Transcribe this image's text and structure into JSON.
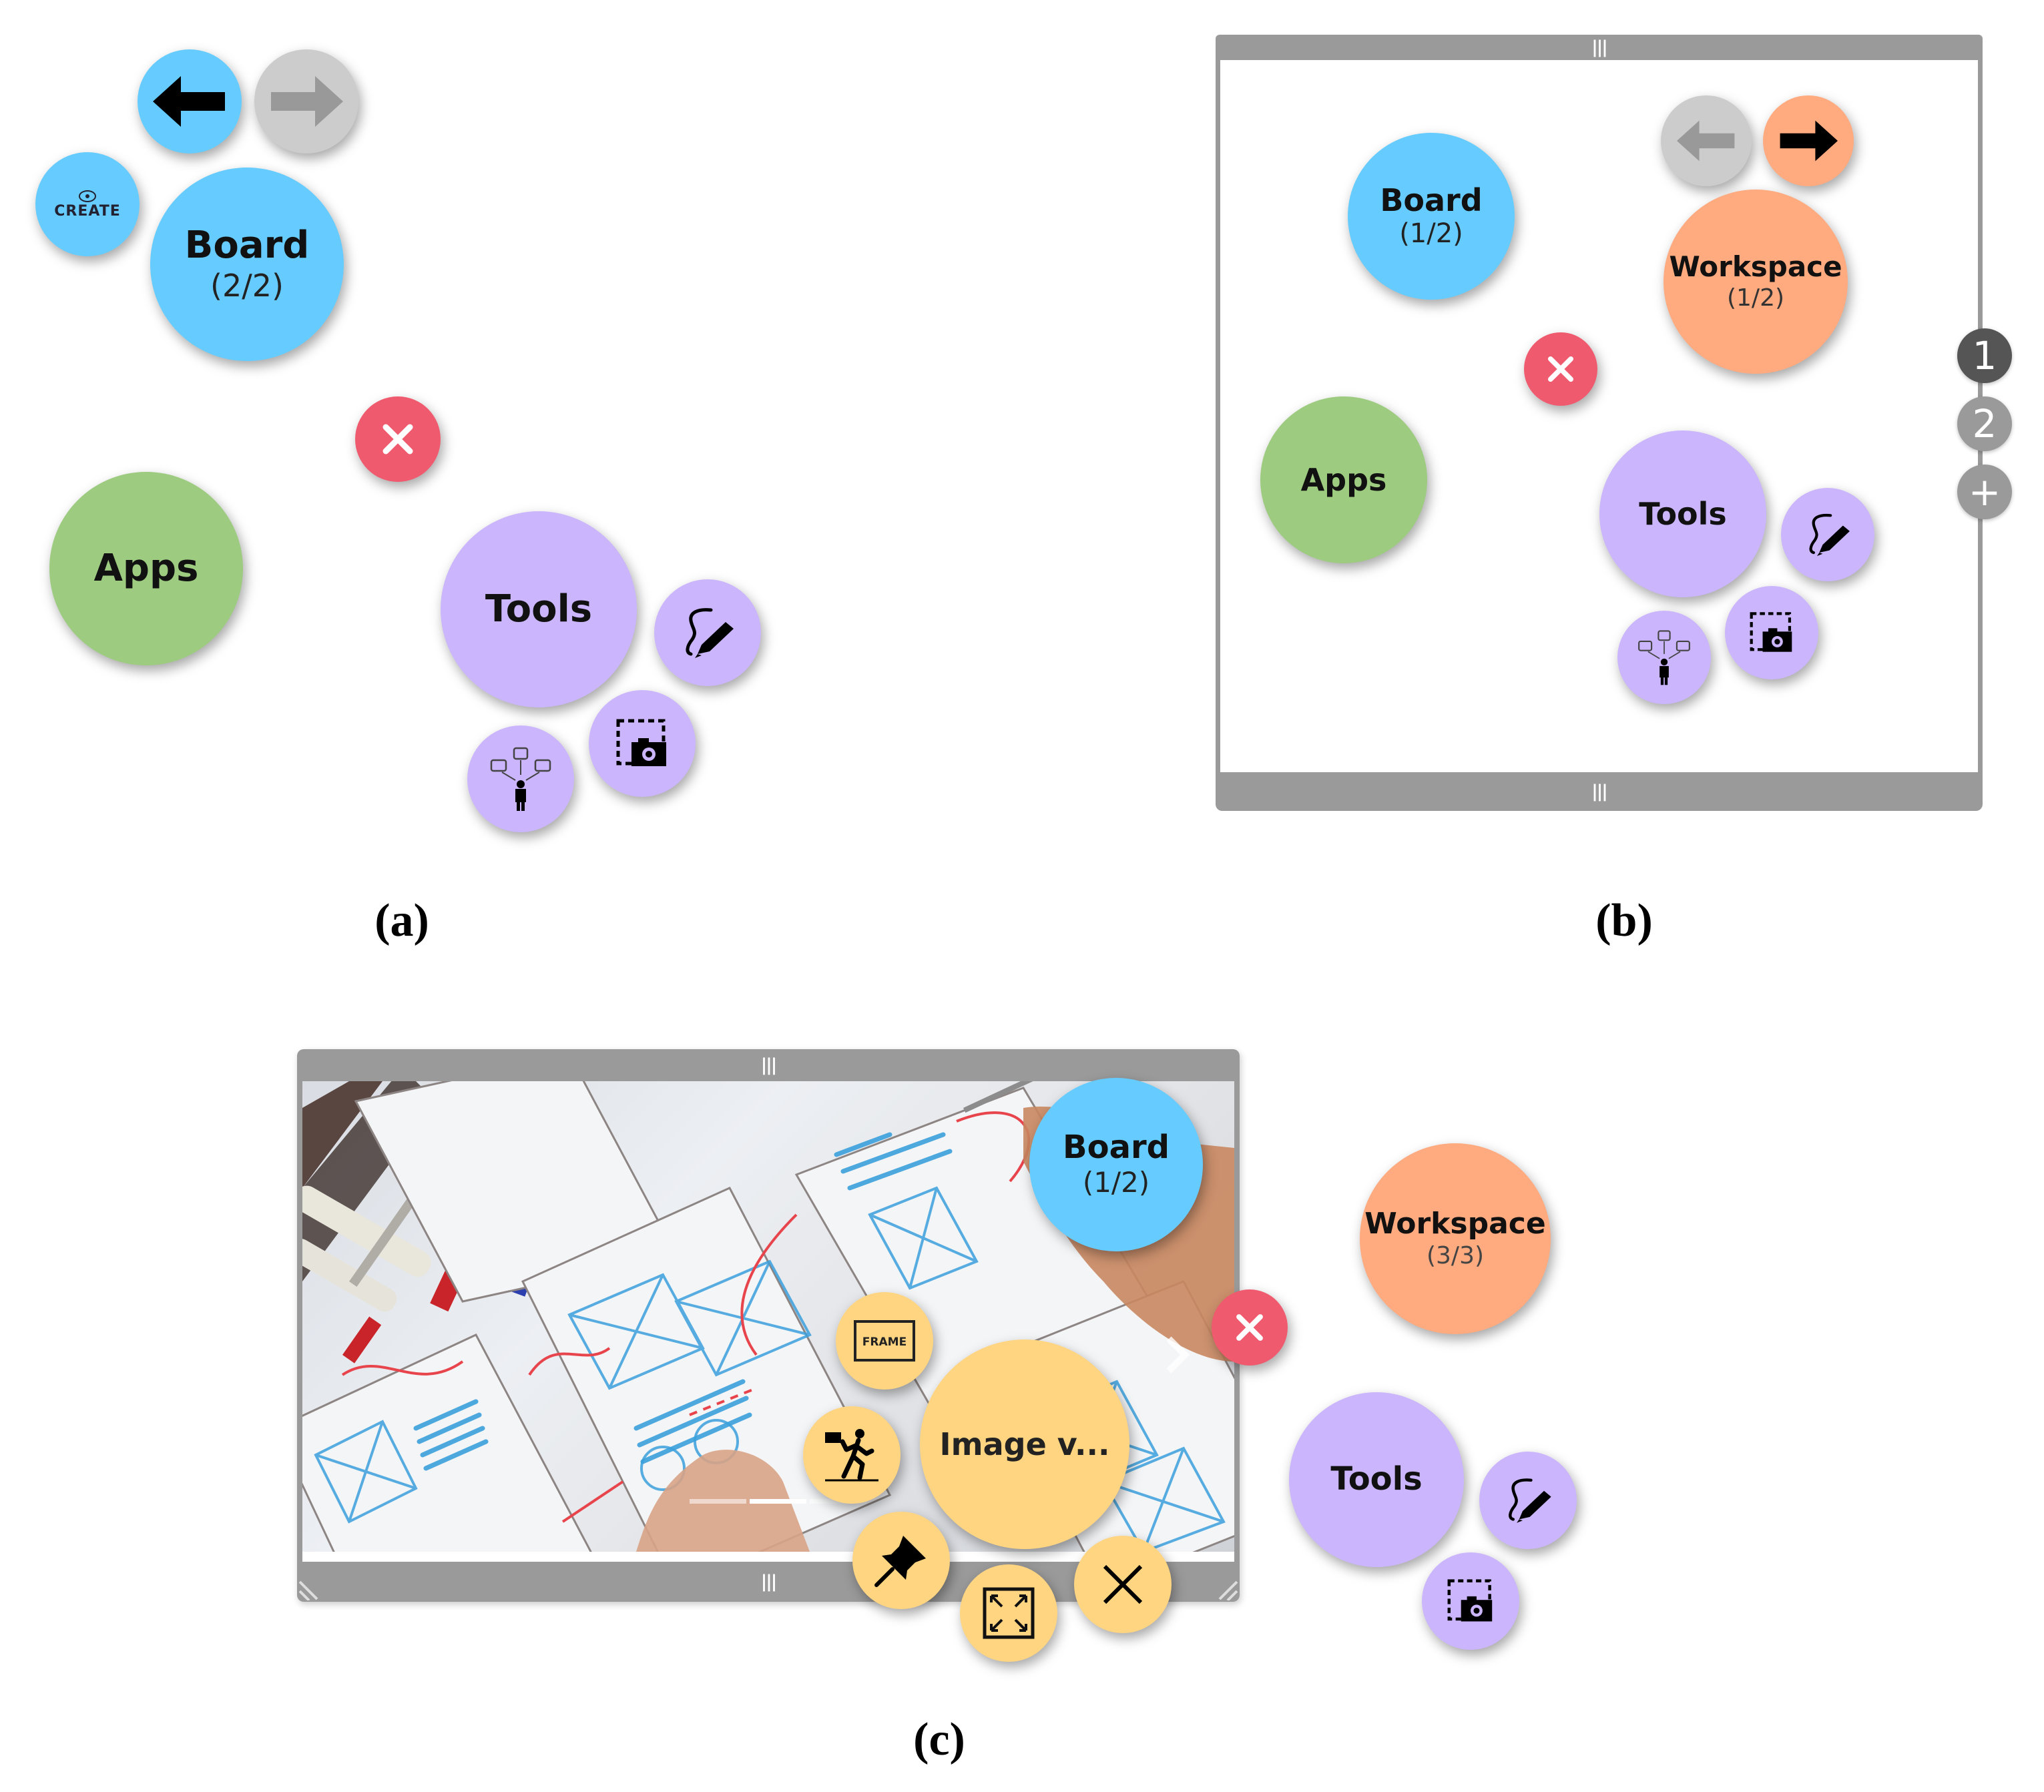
{
  "colors": {
    "board": "#66CCFF",
    "disabled": "#CCCCCC",
    "apps": "#9DCB7F",
    "tools": "#CBB5FD",
    "workspace": "#FFAA7F",
    "close": "#F05A6E",
    "image_viewer": "#FFD581",
    "window_chrome": "#9A9A9A"
  },
  "panel_a": {
    "caption": "(a)",
    "nav_back": {
      "icon": "arrow-left-icon",
      "enabled": true
    },
    "nav_forward": {
      "icon": "arrow-right-icon",
      "enabled": false
    },
    "create": {
      "label": "CREATE",
      "icon": "create-icon"
    },
    "board": {
      "title": "Board",
      "count": "(2/2)"
    },
    "close": {
      "icon": "close-icon"
    },
    "apps": {
      "title": "Apps"
    },
    "tools": {
      "title": "Tools"
    },
    "tool_items": [
      {
        "name": "pen-draw-tool",
        "icon": "pen-squiggle-icon"
      },
      {
        "name": "screenshot-tool",
        "icon": "camera-selection-icon"
      },
      {
        "name": "brainstorm-tool",
        "icon": "person-ideas-icon"
      }
    ]
  },
  "panel_b": {
    "caption": "(b)",
    "top_grip": "|||",
    "bottom_grip": "|||",
    "nav_back": {
      "icon": "arrow-left-icon",
      "enabled": false
    },
    "nav_forward": {
      "icon": "arrow-right-icon",
      "enabled": true
    },
    "board": {
      "title": "Board",
      "count": "(1/2)"
    },
    "workspace": {
      "title": "Workspace",
      "count": "(1/2)"
    },
    "close": {
      "icon": "close-icon"
    },
    "apps": {
      "title": "Apps"
    },
    "tools": {
      "title": "Tools"
    },
    "pages": [
      {
        "label": "1",
        "active": true
      },
      {
        "label": "2",
        "active": false
      },
      {
        "label": "+",
        "active": false
      }
    ]
  },
  "panel_c": {
    "caption": "(c)",
    "top_grip": "|||",
    "bottom_grip": "|||",
    "board": {
      "title": "Board",
      "count": "(1/2)"
    },
    "workspace": {
      "title": "Workspace",
      "count": "(3/3)"
    },
    "close": {
      "icon": "close-icon"
    },
    "tools": {
      "title": "Tools"
    },
    "image_viewer": {
      "title": "Image v...",
      "actions": [
        {
          "name": "frame",
          "label": "FRAME"
        },
        {
          "name": "exit-move",
          "icon": "walk-out-icon"
        },
        {
          "name": "pin",
          "icon": "pin-icon"
        },
        {
          "name": "fullscreen",
          "icon": "expand-icon"
        },
        {
          "name": "close",
          "icon": "x-icon"
        }
      ],
      "slides": {
        "count": 3,
        "active_index": 1
      }
    }
  }
}
